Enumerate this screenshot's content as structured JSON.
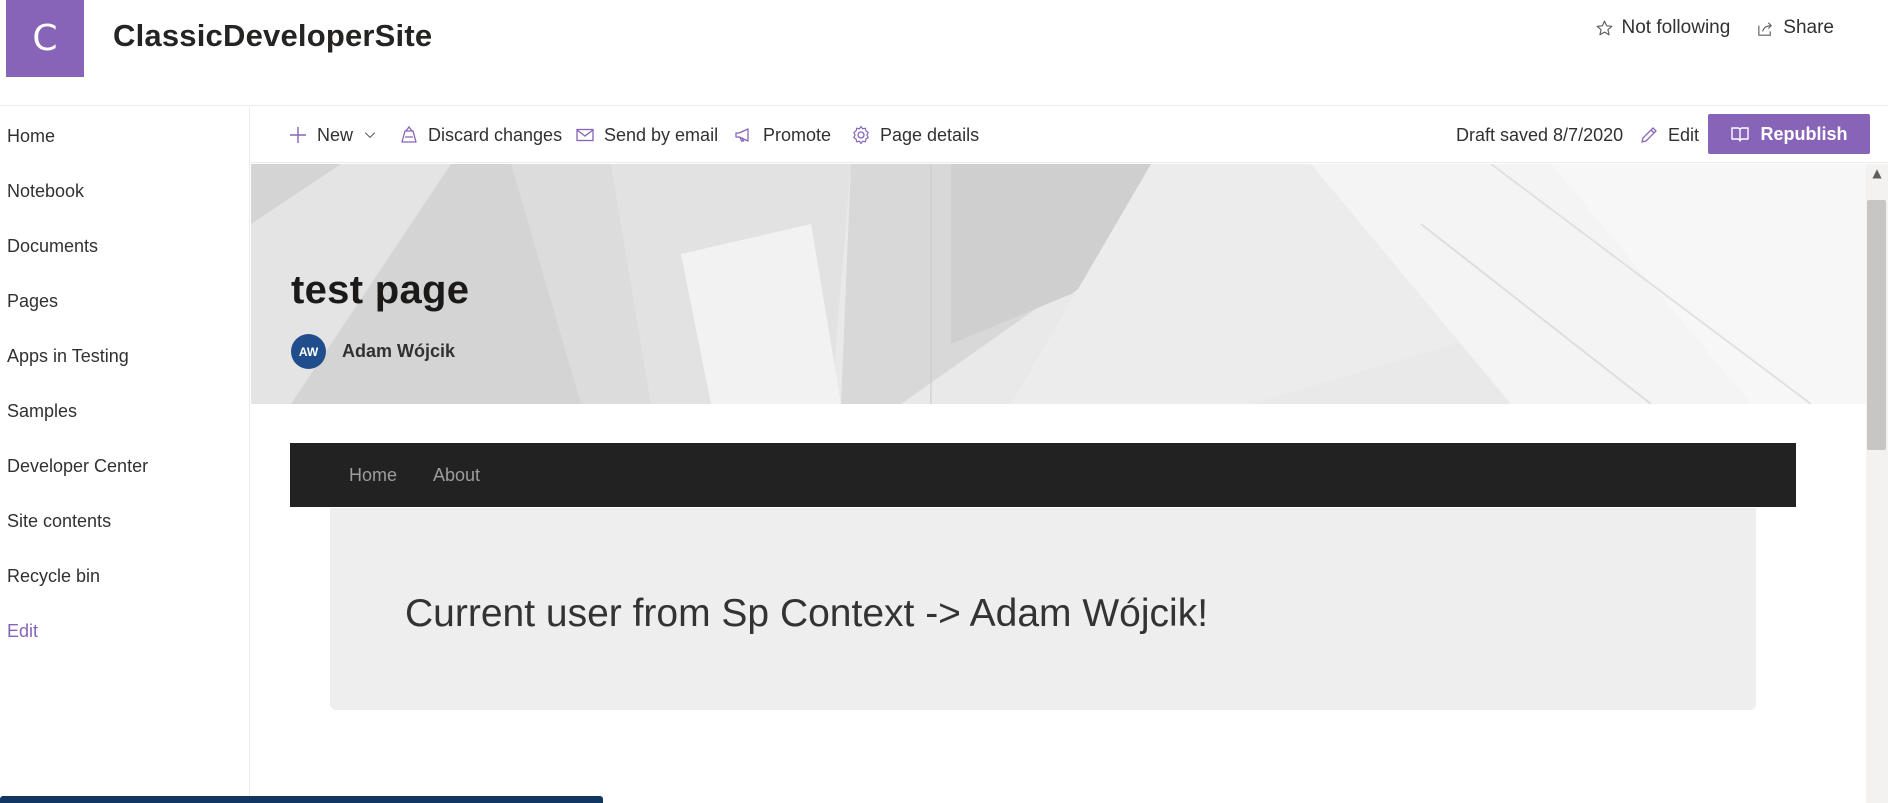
{
  "site": {
    "logo_letter": "C",
    "title": "ClassicDeveloperSite",
    "actions": {
      "follow_label": "Not following",
      "share_label": "Share"
    }
  },
  "nav": {
    "items": [
      {
        "label": "Home"
      },
      {
        "label": "Notebook"
      },
      {
        "label": "Documents"
      },
      {
        "label": "Pages"
      },
      {
        "label": "Apps in Testing"
      },
      {
        "label": "Samples"
      },
      {
        "label": "Developer Center"
      },
      {
        "label": "Site contents"
      },
      {
        "label": "Recycle bin"
      }
    ],
    "edit_label": "Edit"
  },
  "command_bar": {
    "new_label": "New",
    "discard_label": "Discard changes",
    "email_label": "Send by email",
    "promote_label": "Promote",
    "details_label": "Page details",
    "draft_status": "Draft saved 8/7/2020",
    "edit_label": "Edit",
    "republish_label": "Republish"
  },
  "page": {
    "title": "test page",
    "author": {
      "initials": "AW",
      "name": "Adam Wójcik"
    }
  },
  "webpart": {
    "nav_links": [
      {
        "label": "Home"
      },
      {
        "label": "About"
      }
    ],
    "message": "Current user from Sp Context -> Adam Wójcik!"
  },
  "colors": {
    "accent": "#8764b8",
    "avatar": "#204e8c",
    "webpart_nav": "#222222",
    "webpart_panel": "#eeeeee"
  },
  "icons": {
    "follow": "star-icon",
    "share": "share-icon",
    "new": "plus-icon",
    "discard": "discard-icon",
    "email": "mail-icon",
    "promote": "megaphone-icon",
    "details": "gear-icon",
    "edit": "pencil-icon",
    "republish": "book-icon"
  }
}
